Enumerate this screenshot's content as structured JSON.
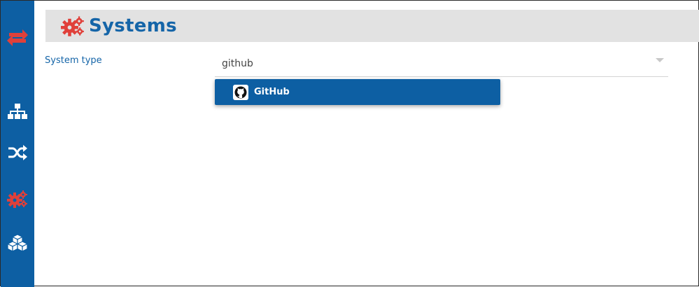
{
  "app": {
    "icons": {
      "logo": "sync-arrows-icon",
      "nav": [
        "sitemap-icon",
        "shuffle-icon",
        "cogs-icon",
        "cubes-icon"
      ]
    },
    "colors": {
      "sidebar": "#0d5fa3",
      "accent_red": "#e0403a",
      "title_blue": "#1565a8",
      "header_bg": "#e2e2e2"
    }
  },
  "header": {
    "title": "Systems",
    "icon": "cogs-icon"
  },
  "form": {
    "system_type_label": "System type",
    "system_type_value": "github"
  },
  "dropdown": {
    "options": [
      {
        "label": "GitHub",
        "icon": "github-icon",
        "highlighted": true
      }
    ]
  }
}
